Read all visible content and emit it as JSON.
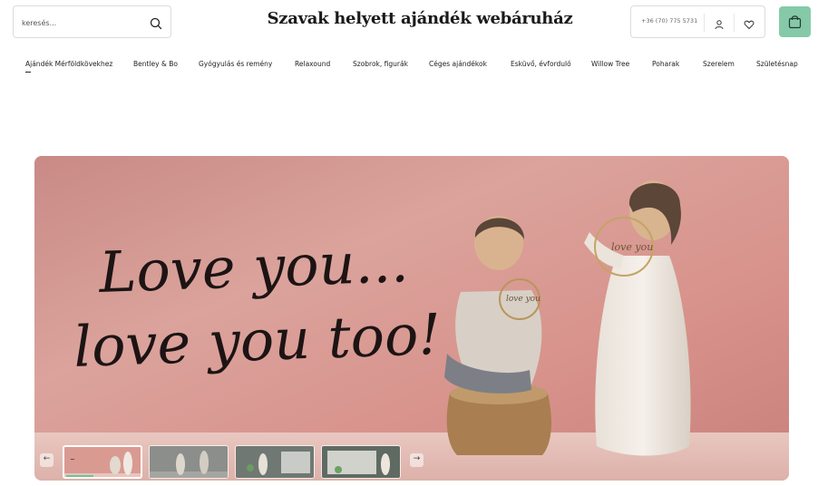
{
  "search": {
    "placeholder": "keresés..."
  },
  "site": {
    "title": "Szavak helyett ajándék webáruház"
  },
  "contact": {
    "phone": "+36 (70) 775 5731"
  },
  "icons": {
    "search": "search-icon",
    "account": "account-icon",
    "wishlist": "heart-icon",
    "cart": "shopping-bag-icon",
    "prev": "arrow-left-icon",
    "next": "arrow-right-icon"
  },
  "colors": {
    "accent": "#86c9a8",
    "hero_bg": "#d99690"
  },
  "nav": {
    "items": [
      {
        "label": "Ajándék Mérföldkövekhez",
        "active": true
      },
      {
        "label": "Bentley & Bo"
      },
      {
        "label": "Gyógyulás és remény"
      },
      {
        "label": "Relaxound"
      },
      {
        "label": "Szobrok, figurák"
      },
      {
        "label": "Céges ajándékok"
      },
      {
        "label": "Esküvő, évforduló"
      },
      {
        "label": "Willow Tree"
      },
      {
        "label": "Poharak"
      },
      {
        "label": "Szerelem"
      },
      {
        "label": "Születésnap"
      }
    ]
  },
  "hero": {
    "script_line1": "Love you...",
    "script_line2": "love you too!",
    "figure_text_left": "love you",
    "figure_text_right": "love you"
  },
  "slider": {
    "active_index": 0,
    "prev_label": "←",
    "next_label": "→",
    "thumbs": [
      {
        "name": "slide-thumb-1"
      },
      {
        "name": "slide-thumb-2"
      },
      {
        "name": "slide-thumb-3"
      },
      {
        "name": "slide-thumb-4"
      }
    ]
  }
}
